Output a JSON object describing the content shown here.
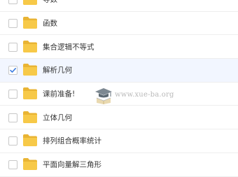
{
  "colors": {
    "folder": "#f7c948",
    "folder_back": "#e9b434",
    "check": "#3a7be0",
    "selected_row": "#f2f6ff"
  },
  "items": [
    {
      "label": "导数",
      "checked": false
    },
    {
      "label": "函数",
      "checked": false
    },
    {
      "label": "集合逻辑不等式",
      "checked": false
    },
    {
      "label": "解析几何",
      "checked": true
    },
    {
      "label": "课前准备!",
      "checked": false
    },
    {
      "label": "立体几何",
      "checked": false
    },
    {
      "label": "排列组合概率统计",
      "checked": false
    },
    {
      "label": "平面向量解三角形",
      "checked": false
    }
  ],
  "watermark": {
    "text": "www.xue-ba.org",
    "icon": "graduation-cap-book-icon"
  }
}
